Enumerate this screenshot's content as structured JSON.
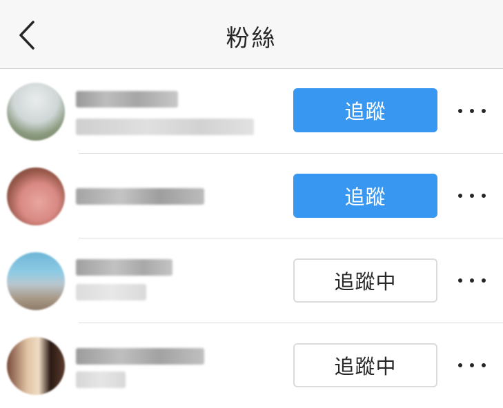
{
  "header": {
    "title": "粉絲",
    "back_icon": "chevron-left-icon"
  },
  "followers": [
    {
      "button_label": "追蹤",
      "button_state": "follow"
    },
    {
      "button_label": "追蹤",
      "button_state": "follow"
    },
    {
      "button_label": "追蹤中",
      "button_state": "following"
    },
    {
      "button_label": "追蹤中",
      "button_state": "following"
    }
  ],
  "more_icon": "more-horizontal-icon",
  "colors": {
    "accent": "#3897f0",
    "header_bg": "#f7f7f7",
    "text": "#262626",
    "divider": "#dcdcdc"
  }
}
